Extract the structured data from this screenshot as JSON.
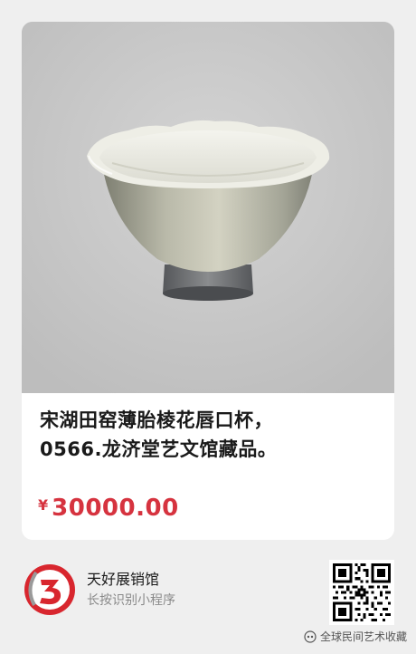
{
  "product": {
    "image_icon": "celadon-lobed-cup-photo",
    "title_line1": "宋湖田窑薄胎棱花唇口杯，",
    "title_line2": "0566.龙济堂艺文馆藏品。",
    "currency_symbol": "¥",
    "price": "30000.00"
  },
  "shop": {
    "logo_icon": "shop-logo-icon",
    "name": "天好展销馆",
    "hint": "长按识别小程序",
    "qr_icon": "qr-code-icon"
  },
  "watermark": {
    "icon": "wechat-channel-icon",
    "text": "全球民间艺术收藏"
  },
  "colors": {
    "price": "#d6333f",
    "background": "#efefef",
    "card": "#ffffff",
    "logo_red": "#d8262e"
  }
}
